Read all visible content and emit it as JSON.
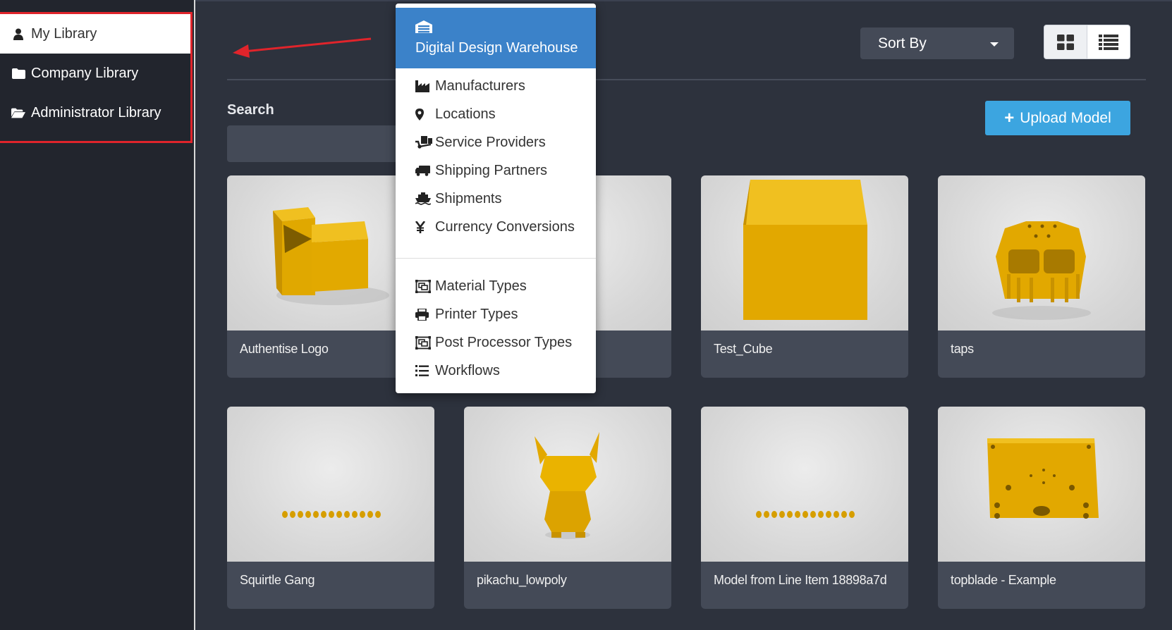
{
  "sidebar": {
    "items": [
      {
        "label": "My Library",
        "icon": "user-icon",
        "active": true
      },
      {
        "label": "Company Library",
        "icon": "folder-icon",
        "active": false
      },
      {
        "label": "Administrator Library",
        "icon": "folder-open-icon",
        "active": false
      }
    ]
  },
  "header": {
    "sort_label": "Sort By",
    "view_modes": [
      "grid-view-icon",
      "list-view-icon"
    ]
  },
  "search": {
    "label": "Search",
    "value": "",
    "placeholder": ""
  },
  "upload_button": {
    "label": "Upload Model",
    "icon": "plus-icon"
  },
  "dropdown": {
    "title": "Digital Design Warehouse",
    "title_icon": "warehouse-icon",
    "section1": [
      {
        "label": "Manufacturers",
        "icon": "industry-icon"
      },
      {
        "label": "Locations",
        "icon": "map-marker-icon"
      },
      {
        "label": "Service Providers",
        "icon": "dolly-icon"
      },
      {
        "label": "Shipping Partners",
        "icon": "truck-icon"
      },
      {
        "label": "Shipments",
        "icon": "ship-icon"
      },
      {
        "label": "Currency Conversions",
        "icon": "yen-icon"
      }
    ],
    "section2": [
      {
        "label": "Material Types",
        "icon": "object-group-icon"
      },
      {
        "label": "Printer Types",
        "icon": "print-icon"
      },
      {
        "label": "Post Processor Types",
        "icon": "object-group-icon"
      },
      {
        "label": "Workflows",
        "icon": "list-ol-icon"
      }
    ]
  },
  "models": [
    {
      "name": "Authentise Logo"
    },
    {
      "name": ""
    },
    {
      "name": "Test_Cube"
    },
    {
      "name": "taps"
    },
    {
      "name": "Squirtle Gang"
    },
    {
      "name": "pikachu_lowpoly"
    },
    {
      "name": "Model from Line Item 18898a7d"
    },
    {
      "name": "topblade - Example"
    }
  ],
  "colors": {
    "background": "#2d323d",
    "sidebar": "#22252d",
    "accent_blue": "#3ca5e0",
    "dropdown_header": "#3b82c9",
    "annotation_red": "#e0242b",
    "model_yellow": "#e2a800"
  }
}
